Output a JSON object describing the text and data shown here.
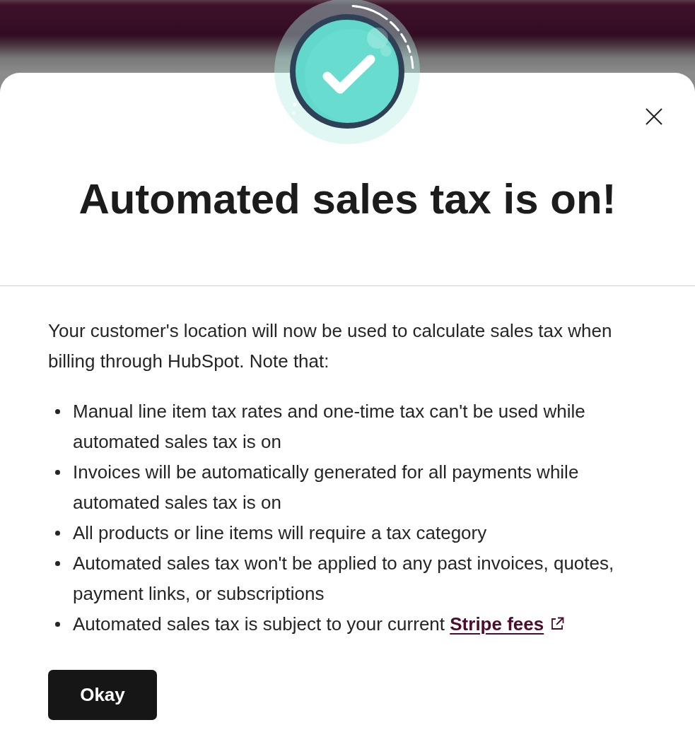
{
  "dialog": {
    "title": "Automated sales tax is on!",
    "intro": "Your customer's location will now be used to calculate sales tax when billing through HubSpot. Note that:",
    "notes": [
      {
        "text": "Manual line item tax rates and one-time tax can't be used while automated sales tax is on"
      },
      {
        "text": "Invoices will be automatically generated for all payments while automated sales tax is on"
      },
      {
        "text": "All products or line items will require a tax category"
      },
      {
        "text": "Automated sales tax won't be applied to any past invoices, quotes, payment links, or subscriptions"
      },
      {
        "text": "Automated sales tax is subject to your current",
        "link": "Stripe fees"
      }
    ],
    "button": "Okay"
  }
}
